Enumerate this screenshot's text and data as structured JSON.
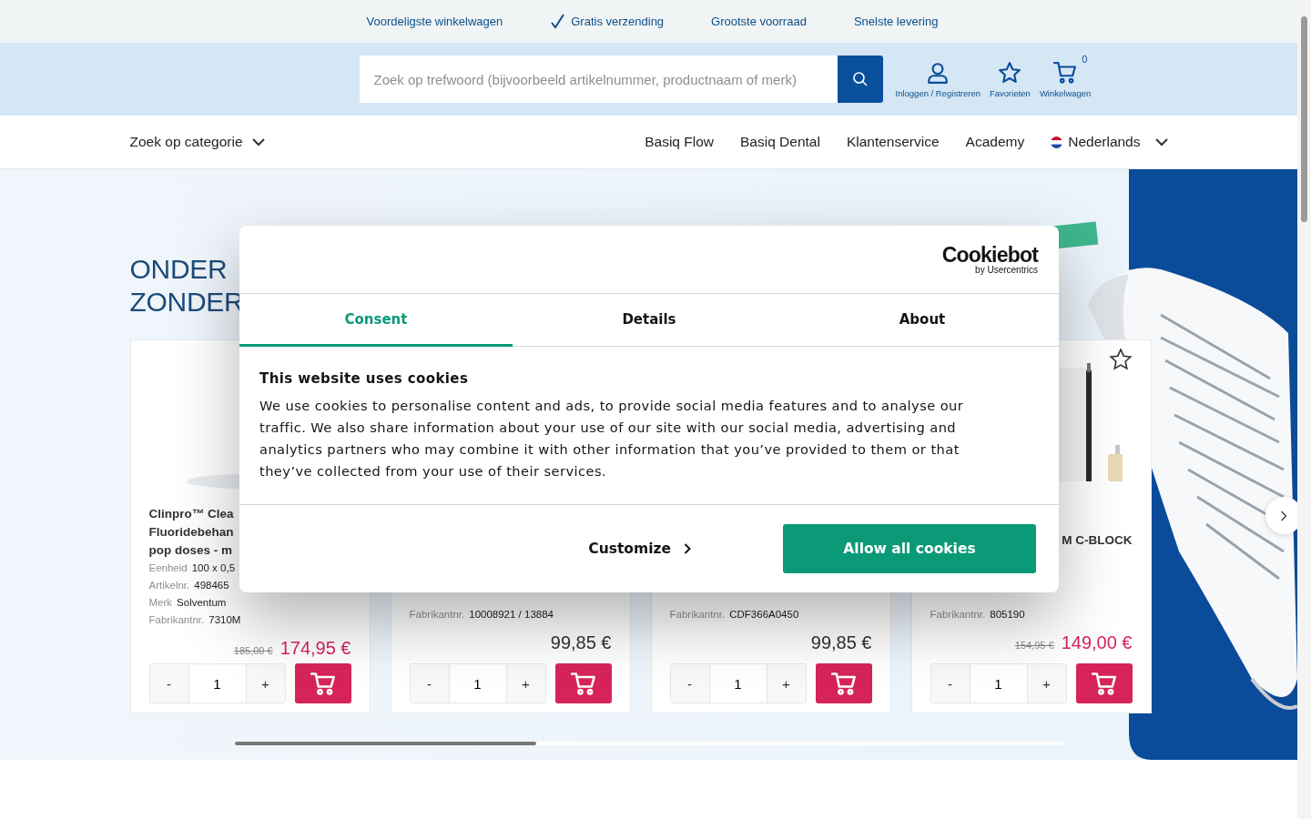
{
  "top_bar": {
    "items": [
      {
        "label": "Voordeligste winkelwagen",
        "checked": false
      },
      {
        "label": "Gratis verzending",
        "checked": true
      },
      {
        "label": "Grootste voorraad",
        "checked": false
      },
      {
        "label": "Snelste levering",
        "checked": false
      }
    ]
  },
  "header": {
    "search": {
      "placeholder": "Zoek op trefwoord (bijvoorbeeld artikelnummer, productnaam of merk)"
    },
    "actions": [
      {
        "kind": "user",
        "label": "Inloggen / Registreren"
      },
      {
        "kind": "star",
        "label": "Favorieten"
      },
      {
        "kind": "cart",
        "label": "Winkelwagen",
        "count": "0"
      }
    ]
  },
  "nav": {
    "category": "Zoek op categorie",
    "links": [
      "Basiq Flow",
      "Basiq Dental",
      "Klantenservice",
      "Academy"
    ],
    "language": "Nederlands"
  },
  "hero": {
    "headline": [
      "ONDER",
      "ZONDER"
    ]
  },
  "products": [
    {
      "title_lines": [
        "Clinpro™ Clea",
        "Fluoridebehan",
        "pop doses - m"
      ],
      "specs": [
        {
          "label": "Eenheid",
          "value": "100 x 0,5"
        },
        {
          "label": "Artikelnr.",
          "value": "498465"
        },
        {
          "label": "Merk",
          "value": "Solventum"
        },
        {
          "label": "Fabrikantnr.",
          "value": "7310M"
        }
      ],
      "old_price": "185,00 €",
      "price": "174,95 €",
      "sale": true,
      "quantity": "1",
      "minus": "-",
      "plus": "+"
    },
    {
      "specs": [
        {
          "label": "Fabrikantnr.",
          "value": "10008921 / 13884"
        }
      ],
      "price": "99,85 €",
      "sale": false,
      "quantity": "1",
      "minus": "-",
      "plus": "+"
    },
    {
      "specs": [
        {
          "label": "Fabrikantnr.",
          "value": "CDF366A0450"
        }
      ],
      "price": "99,85 €",
      "sale": false,
      "quantity": "1",
      "minus": "-",
      "plus": "+"
    },
    {
      "favorite": false,
      "title_lines": [
        "M C-BLOCK"
      ],
      "specs": [
        {
          "label": "Fabrikantnr.",
          "value": "805190"
        }
      ],
      "old_price": "154,95 €",
      "price": "149,00 €",
      "sale": true,
      "quantity": "1",
      "minus": "-",
      "plus": "+"
    }
  ],
  "cookie_dialog": {
    "brand": "Cookiebot",
    "brand_sub": "by Usercentrics",
    "tabs": [
      {
        "label": "Consent",
        "selected": true
      },
      {
        "label": "Details",
        "selected": false
      },
      {
        "label": "About",
        "selected": false
      }
    ],
    "title": "This website uses cookies",
    "text": "We use cookies to personalise content and ads, to provide social media features and to analyse our traffic. We also share information about your use of our site with our social media, advertising and analytics partners who may combine it with other information that you’ve provided to them or that they’ve collected from your use of their services.",
    "customize": "Customize",
    "allow": "Allow all cookies"
  }
}
